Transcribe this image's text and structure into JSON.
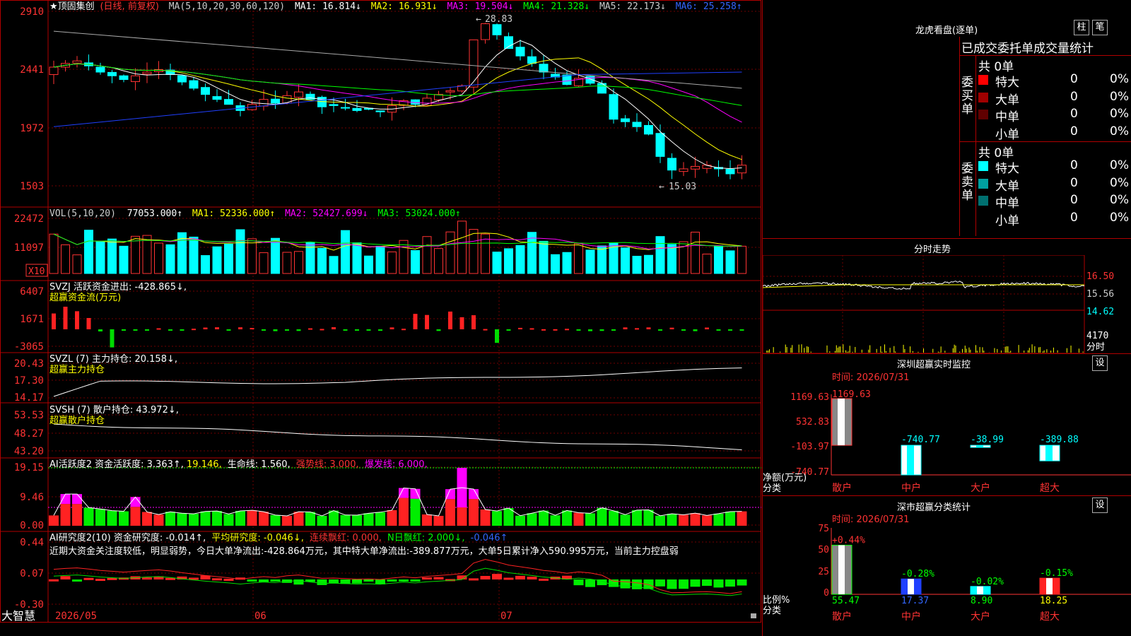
{
  "stock_title": "★顶固集创",
  "stock_mode": "(日线, 前复权)",
  "ma_legend": {
    "label": "MA(5,10,20,30,60,120)",
    "ma1": "MA1: 16.814↓",
    "ma2": "MA2: 16.931↓",
    "ma3": "MA3: 19.504↓",
    "ma4": "MA4: 21.328↓",
    "ma5": "MA5: 22.173↓",
    "ma6": "MA6: 25.258↑"
  },
  "price_axis": [
    "2910",
    "2441",
    "1972",
    "1503"
  ],
  "price_high_label": "28.83",
  "price_low_label": "15.03",
  "vol_legend": {
    "label": "VOL(5,10,20)",
    "value": "77053.000↑",
    "ma1": "MA1: 52336.000↑",
    "ma2": "MA2: 52427.699↓",
    "ma3": "MA3: 53024.000↑"
  },
  "vol_axis": [
    "22472",
    "11097"
  ],
  "vol_unit": "X10",
  "svzj": {
    "label": "SVZJ  活跃资金进出: -428.865↓,",
    "sub": "超赢资金流(万元)",
    "axis": [
      "6407",
      "1671",
      "-3065"
    ]
  },
  "svzl": {
    "label": "SVZL (7) 主力持仓: 20.158↓,",
    "sub": "超赢主力持仓",
    "axis": [
      "20.43",
      "17.30",
      "14.17"
    ]
  },
  "svsh": {
    "label": "SVSH (7) 散户持仓: 43.972↓,",
    "sub": "超赢散户持仓",
    "axis": [
      "53.53",
      "48.27",
      "43.20"
    ]
  },
  "ai_active": {
    "label": "AI活跃度2 资金活跃度: 3.363↑,",
    "v2": "19.146,",
    "life": "生命线: 1.560,",
    "strong": "强势线: 3.000,",
    "burst": "爆发线: 6.000,",
    "axis": [
      "19.15",
      "9.46",
      "0.00"
    ]
  },
  "ai_research": {
    "label": "AI研究度2(10) 资金研究度: -0.014↑,",
    "avg": "平均研究度: -0.046↓,",
    "cont": "连续飘红: 0.000,",
    "nday": "N日飘红: 2.000↓,",
    "last": "-0.046↑",
    "commentary": "近期大资金关注度较低，明显弱势，今日大单净流出:-428.864万元，其中特大单净流出:-389.877万元，大单5日累计净入590.995万元，当前主力控盘弱",
    "axis": [
      "0.44",
      "0.07",
      "-0.30"
    ]
  },
  "date_axis": [
    "2026/05",
    "06",
    "07"
  ],
  "brand": "大智慧",
  "longhu": {
    "title": "龙虎看盘(逐单)",
    "btn_zhu": "柱",
    "btn_bi": "笔",
    "header": "已成交委托单成交量统计",
    "buy_label": "委买单",
    "sell_label": "委卖单",
    "buy_total": "共 0单",
    "sell_total": "共 0单",
    "buy_rows": [
      {
        "name": "特大",
        "count": "0",
        "pct": "0%",
        "color": "#ff0000"
      },
      {
        "name": "大单",
        "count": "0",
        "pct": "0%",
        "color": "#a00000"
      },
      {
        "name": "中单",
        "count": "0",
        "pct": "0%",
        "color": "#600000"
      },
      {
        "name": "小单",
        "count": "0",
        "pct": "0%",
        "color": "#000000"
      }
    ],
    "sell_rows": [
      {
        "name": "特大",
        "count": "0",
        "pct": "0%",
        "color": "#00ffff"
      },
      {
        "name": "大单",
        "count": "0",
        "pct": "0%",
        "color": "#00a0a0"
      },
      {
        "name": "中单",
        "count": "0",
        "pct": "0%",
        "color": "#007070"
      },
      {
        "name": "小单",
        "count": "0",
        "pct": "0%",
        "color": "#000000"
      }
    ]
  },
  "fenshi": {
    "title": "分时走势",
    "axis": [
      "16.50",
      "15.56",
      "14.62"
    ],
    "vol_label": "4170",
    "vol_unit": "分时"
  },
  "sz_monitor": {
    "title": "深圳超赢实时监控",
    "set": "设",
    "time": "时间: 2026/07/31",
    "axis": [
      "1169.63",
      "532.83",
      "-103.97",
      "-740.77"
    ],
    "ylabel1": "净额(万元)",
    "ylabel2": "分类",
    "bars": [
      {
        "cat": "散户",
        "value": 1169.63,
        "label": "1169.63"
      },
      {
        "cat": "中户",
        "value": -740.77,
        "label": "-740.77"
      },
      {
        "cat": "大户",
        "value": -38.99,
        "label": "-38.99"
      },
      {
        "cat": "超大",
        "value": -389.88,
        "label": "-389.88"
      }
    ]
  },
  "sz_class": {
    "title": "深市超赢分类统计",
    "set": "设",
    "time": "时间: 2026/07/31",
    "axis": [
      "75",
      "50",
      "25",
      "0"
    ],
    "ylabel1": "比例%",
    "ylabel2": "分类",
    "bars": [
      {
        "cat": "散户",
        "value": 55.47,
        "label": "55.47",
        "delta": "+0.44%"
      },
      {
        "cat": "中户",
        "value": 17.37,
        "label": "17.37",
        "delta": "-0.28%"
      },
      {
        "cat": "大户",
        "value": 8.9,
        "label": "8.90",
        "delta": "-0.02%"
      },
      {
        "cat": "超大",
        "value": 18.25,
        "label": "18.25",
        "delta": "-0.15%"
      }
    ]
  },
  "colors": {
    "up": "#ff3333",
    "down": "#00ffff",
    "grid": "#b00000",
    "ma1": "#ffffff",
    "ma2": "#ffff00",
    "ma3": "#ff00ff",
    "ma4": "#00ff00",
    "ma5": "#c0c0c0",
    "ma6": "#0000ff"
  }
}
